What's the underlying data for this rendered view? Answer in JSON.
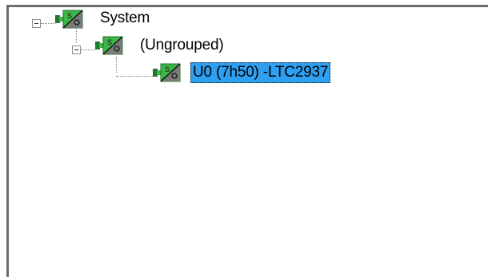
{
  "tree": {
    "nodes": [
      {
        "label": "System",
        "icon": "sensor-module-icon",
        "expanded": true
      },
      {
        "label": "(Ungrouped)",
        "icon": "sensor-module-icon",
        "expanded": true
      },
      {
        "label": "U0 (7h50) -LTC2937",
        "icon": "sensor-module-icon",
        "selected": true
      }
    ]
  },
  "colors": {
    "selection": "#2f9ff1",
    "icon_green": "#3cb54a",
    "icon_dark_green": "#1f7a2e",
    "border": "#6e6e6e"
  }
}
